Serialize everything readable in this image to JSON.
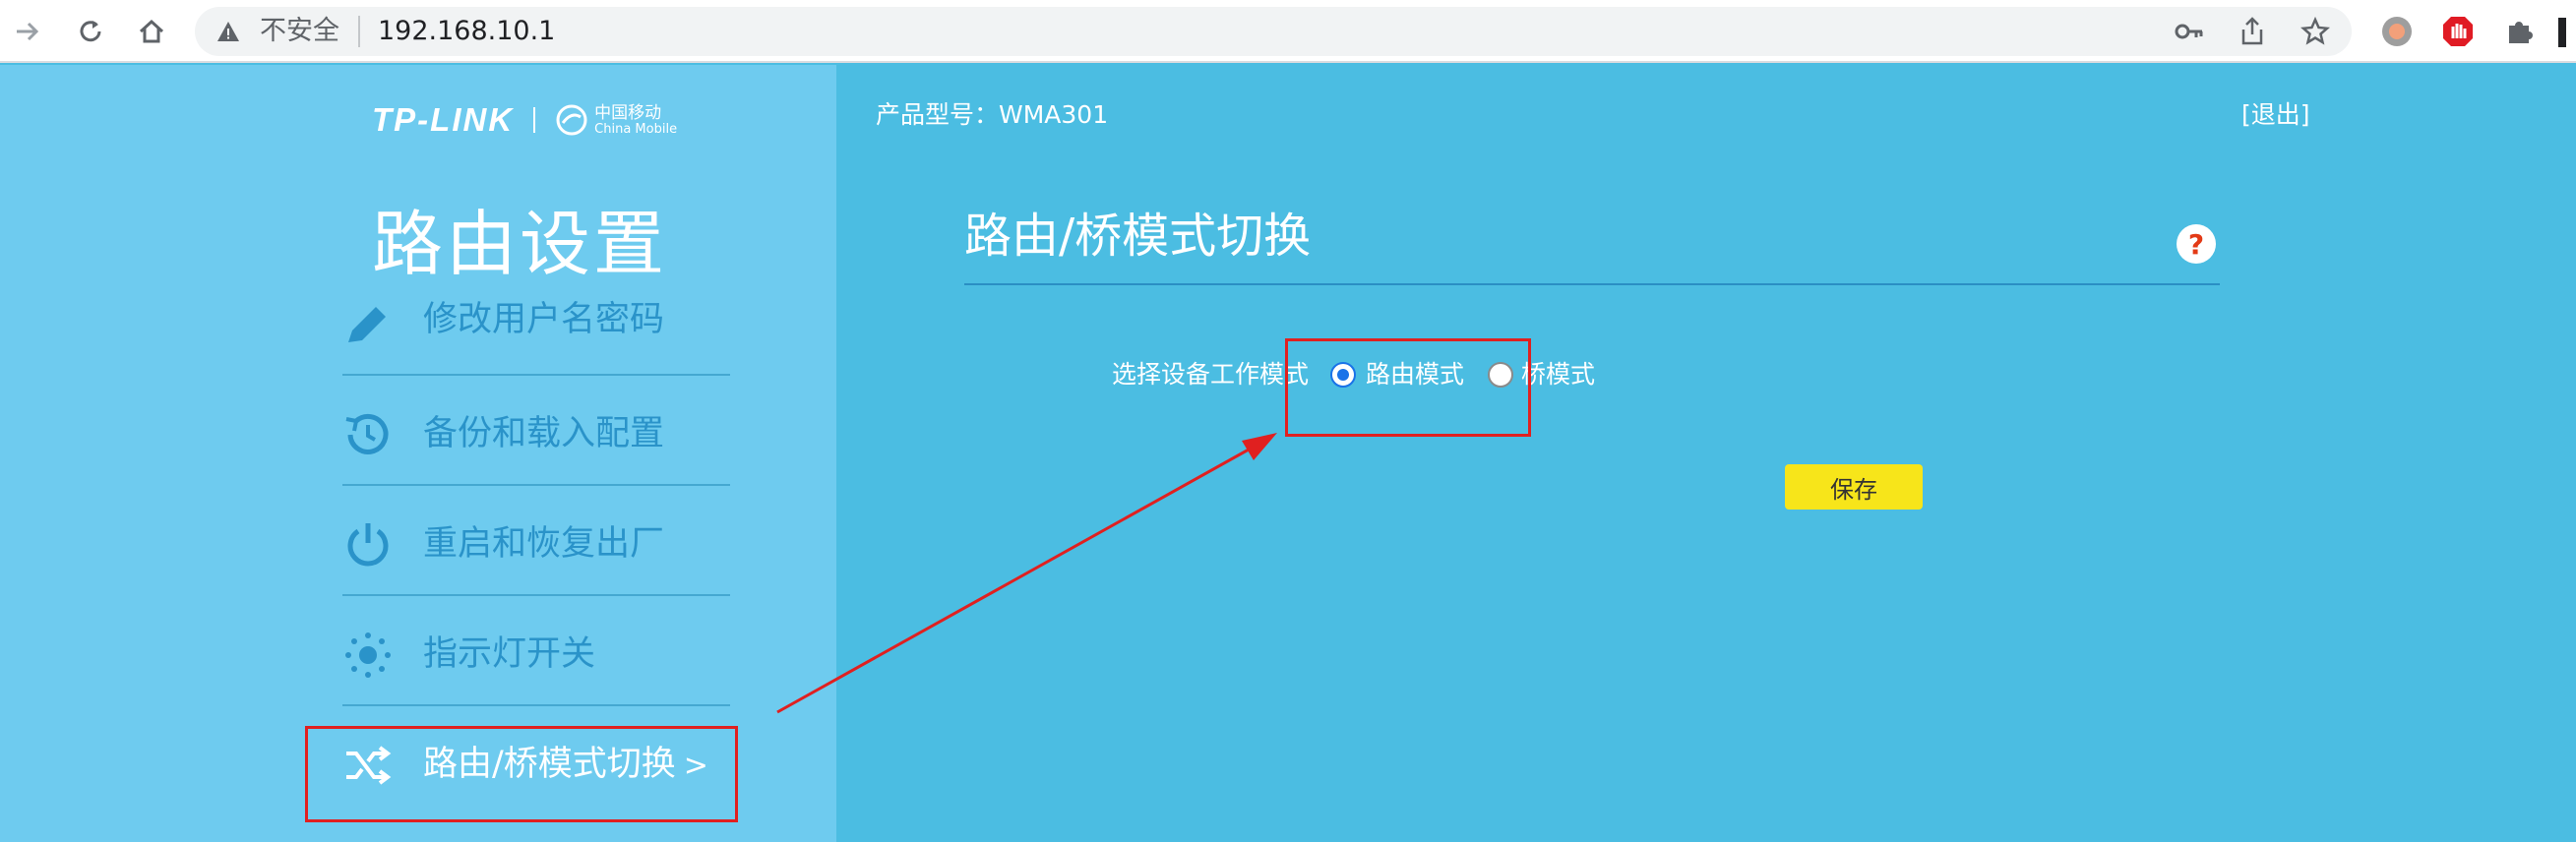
{
  "browser": {
    "security_text": "不安全",
    "url": "192.168.10.1"
  },
  "sidebar": {
    "brand_tplink": "TP-LINK",
    "brand_cm_cn": "中国移动",
    "brand_cm_en": "China Mobile",
    "section_title": "路由设置",
    "items": [
      {
        "label": "修改用户名密码"
      },
      {
        "label": "备份和载入配置"
      },
      {
        "label": "重启和恢复出厂"
      },
      {
        "label": "指示灯开关"
      },
      {
        "label": "路由/桥模式切换",
        "arrow": ">"
      }
    ]
  },
  "main": {
    "model": "产品型号：WMA301",
    "logout": "[退出]",
    "title": "路由/桥模式切换",
    "help": "?",
    "mode_label": "选择设备工作模式",
    "options": [
      {
        "label": "路由模式",
        "selected": true
      },
      {
        "label": "桥模式",
        "selected": false
      }
    ],
    "save_label": "保存"
  },
  "colors": {
    "sidebar_bg": "#6ecbef",
    "main_bg": "#4bbde2",
    "menu_text": "#2a93c9",
    "save_btn": "#f7e51a",
    "annotation": "#e02020"
  }
}
